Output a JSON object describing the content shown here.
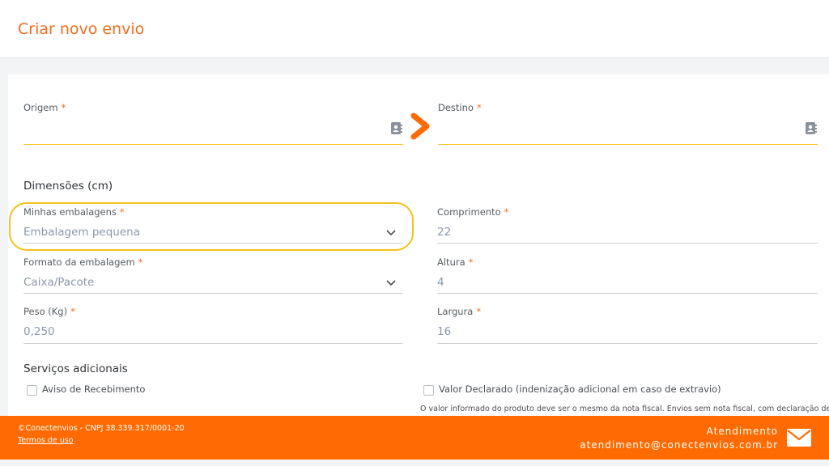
{
  "header": {
    "title": "Criar novo envio"
  },
  "form": {
    "origem": {
      "label": "Origem",
      "required": "*",
      "value": ""
    },
    "destino": {
      "label": "Destino",
      "required": "*",
      "value": ""
    },
    "dimensions_title": "Dimensões (cm)",
    "minhas_embalagens": {
      "label": "Minhas embalagens",
      "required": "*",
      "value": "Embalagem pequena"
    },
    "comprimento": {
      "label": "Comprimento",
      "required": "*",
      "value": "22"
    },
    "formato": {
      "label": "Formato da embalagem",
      "required": "*",
      "value": "Caixa/Pacote"
    },
    "altura": {
      "label": "Altura",
      "required": "*",
      "value": "4"
    },
    "peso": {
      "label": "Peso (Kg)",
      "required": "*",
      "value": "0,250"
    },
    "largura": {
      "label": "Largura",
      "required": "*",
      "value": "16"
    },
    "services_title": "Serviços adicionais",
    "aviso": {
      "label": "Aviso de Recebimento",
      "checked": false
    },
    "valor_declarado": {
      "label": "Valor Declarado (indenização adicional em caso de extravio)",
      "checked": false
    },
    "note": "O valor informado do produto deve ser o mesmo da nota fiscal. Envios sem nota fiscal, com declaração de"
  },
  "footer": {
    "copyright": "©Conectenvios - CNPJ 38.339.317/0001-20",
    "terms": "Termos de uso",
    "support_title": "Atendimento",
    "support_email": "atendimento@conectenvios.com.br"
  },
  "colors": {
    "brand": "#ff6b00",
    "title": "#f26b1d",
    "highlight": "#f4c21c",
    "active_line": "#f4c21c"
  },
  "icons": [
    "contact-book-icon",
    "chevron-right-icon",
    "chevron-down-icon",
    "mail-icon"
  ]
}
